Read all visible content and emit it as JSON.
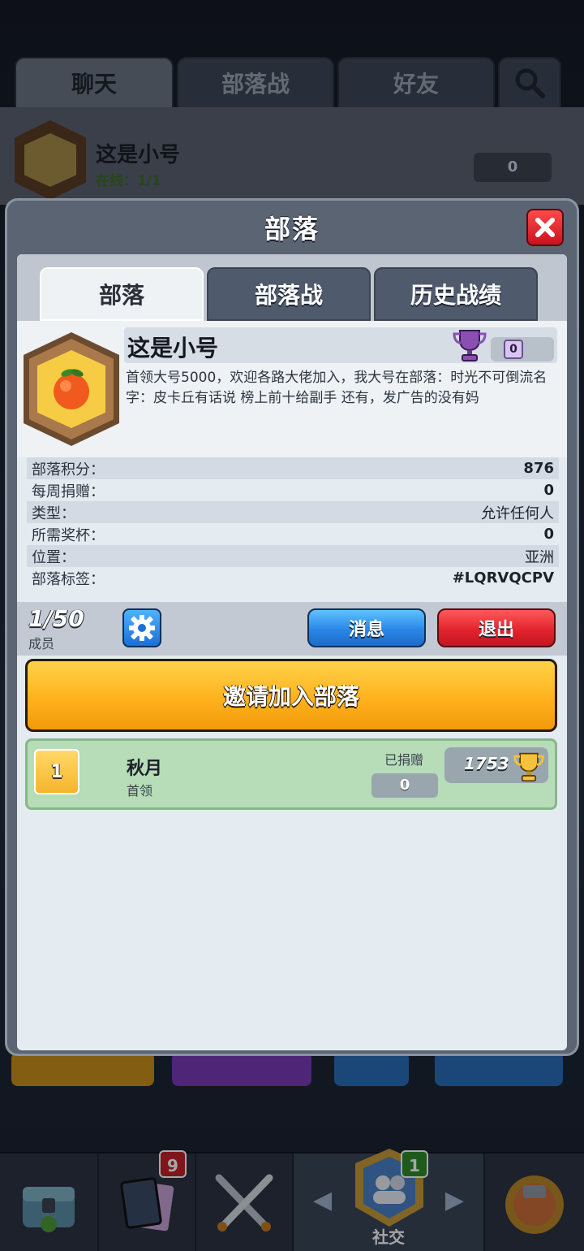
{
  "background": {
    "tabs": [
      "聊天",
      "部落战",
      "好友"
    ],
    "clan_strip": {
      "name": "这是小号",
      "online": "在线：1/1",
      "trophies": "0"
    },
    "nav": {
      "cards_badge": "9",
      "social_badge": "1",
      "social_label": "社交"
    }
  },
  "modal": {
    "title": "部落",
    "tabs": [
      "部落",
      "部落战",
      "历史战绩"
    ],
    "clan": {
      "name": "这是小号",
      "trophies": "0",
      "description": "首领大号5000，欢迎各路大佬加入，我大号在部落：时光不可倒流名字：皮卡丘有话说 榜上前十给副手 还有，发广告的没有妈"
    },
    "info": [
      {
        "label": "部落积分：",
        "value": "876"
      },
      {
        "label": "每周捐赠：",
        "value": "0"
      },
      {
        "label": "类型：",
        "value": "允许任何人"
      },
      {
        "label": "所需奖杯：",
        "value": "0"
      },
      {
        "label": "位置：",
        "value": "亚洲"
      },
      {
        "label": "部落标签：",
        "value": "#LQRVQCPV"
      }
    ],
    "members": {
      "count": "1/50",
      "label": "成员"
    },
    "buttons": {
      "message": "消息",
      "quit": "退出",
      "invite": "邀请加入部落"
    },
    "member_list": [
      {
        "rank": "1",
        "name": "秋月",
        "role": "首领",
        "donated_label": "已捐赠",
        "donated": "0",
        "trophies": "1753"
      }
    ]
  },
  "colors": {
    "accent_blue": "#2a86e6",
    "accent_red": "#e3242e",
    "accent_gold": "#ffb21c",
    "leader_row": "#b6dcb8"
  }
}
